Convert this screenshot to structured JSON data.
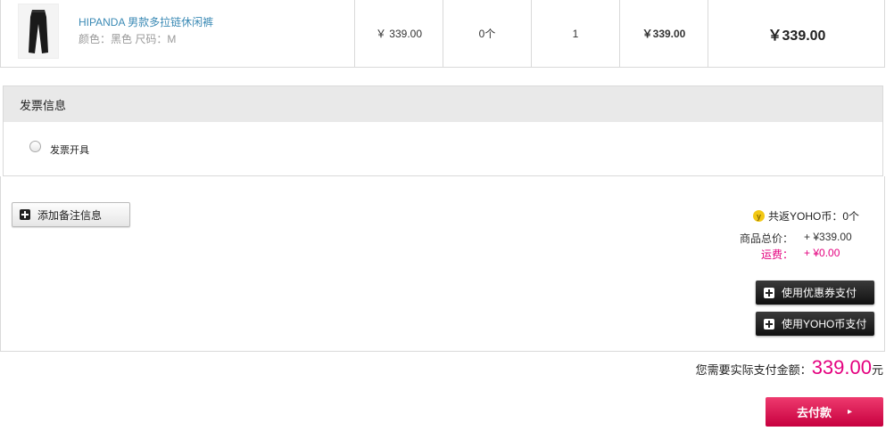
{
  "product": {
    "name": "HIPANDA 男款多拉链休闲裤",
    "attributes": "颜色：黑色 尺码：M",
    "unit_price": "￥ 339.00",
    "coins": "0个",
    "quantity": "1",
    "subtotal": "￥339.00",
    "total": "￥339.00"
  },
  "invoice": {
    "title": "发票信息",
    "option_label": "发票开具"
  },
  "summary": {
    "add_note_label": "添加备注信息",
    "coin_return": "共返YOHO币：0个",
    "goods_total_label": "商品总价：",
    "goods_total_value": "+ ¥339.00",
    "shipping_label": "运费：",
    "shipping_value": "+ ¥0.00",
    "use_coupon_label": "使用优惠券支付",
    "use_coin_label": "使用YOHO币支付"
  },
  "payment": {
    "amount_label": "您需要实际支付金额：",
    "amount": "339.00",
    "unit": "元",
    "pay_button": "去付款"
  },
  "colors": {
    "accent": "#e4007f",
    "link": "#3b8ab5"
  }
}
